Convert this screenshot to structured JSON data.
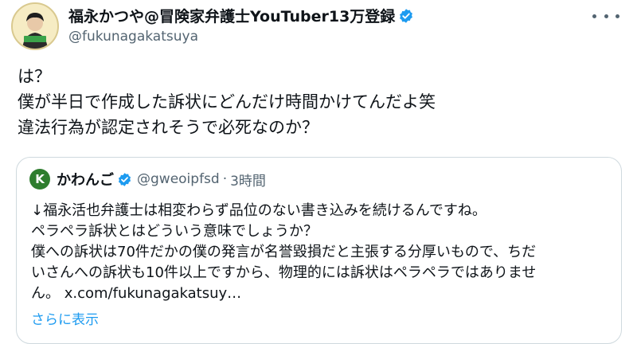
{
  "colors": {
    "verified": "#1d9bf0",
    "link": "#1d9bf0",
    "secondary_text": "#536471",
    "border": "#cfd9de"
  },
  "icons": {
    "verified": "verified-badge-icon",
    "more": "more-horizontal-icon"
  },
  "tweet": {
    "display_name": "福永かつや@冒険家弁護士YouTuber13万登録",
    "handle": "@fukunagakatsuya",
    "lines": [
      "は？",
      "僕が半日で作成した訴状にどんだけ時間かけてんだよ笑",
      "違法行為が認定されそうで必死なのか？"
    ]
  },
  "quote": {
    "avatar_letter": "K",
    "display_name": "かわんご",
    "handle": "@gweoipfsd",
    "separator": "·",
    "time": "3時間",
    "lines": [
      "↓福永活也弁護士は相変わらず品位のない書き込みを続けるんですね。",
      "ペラペラ訴状とはどういう意味でしょうか？",
      "僕への訴状は70件だかの僕の発言が名誉毀損だと主張する分厚いもので、ちだ",
      "いさんへの訴状も10件以上ですから、物理的には訴状はペラペラではありませ"
    ],
    "last_line_text": "ん。",
    "last_line_link": "x.com/fukunagakatsuy…",
    "show_more": "さらに表示"
  }
}
